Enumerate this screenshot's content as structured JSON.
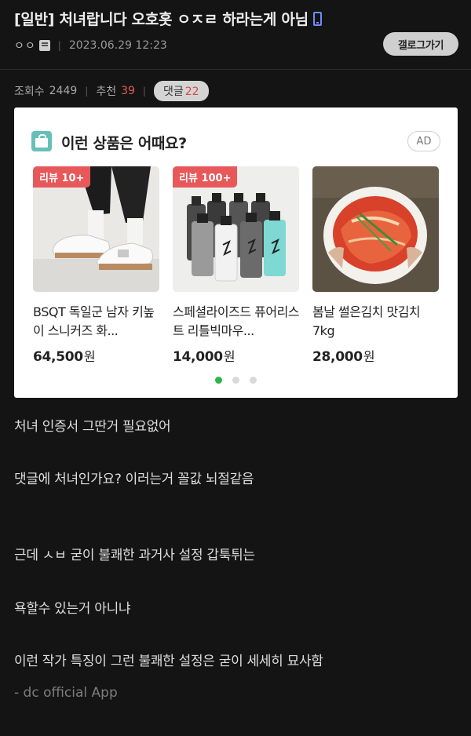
{
  "header": {
    "title": "[일반] 처녀랍니다 오호홋 ㅇㅈㄹ 하라는게 아님",
    "writer": "ㅇㅇ",
    "date": "2023.06.29 12:23",
    "gallery_button": "갤로그가기"
  },
  "stats": {
    "views_label": "조회수",
    "views": "2449",
    "recommend_label": "추천",
    "recommend": "39",
    "comments_label": "댓글",
    "comments": "22"
  },
  "ad": {
    "heading": "이런 상품은 어때요?",
    "badge": "AD",
    "products": [
      {
        "tag": "리뷰 10+",
        "name": "BSQT 독일군 남자 키높이 스니커즈 화...",
        "price": "64,500",
        "unit": "원"
      },
      {
        "tag": "리뷰 100+",
        "name": "스페셜라이즈드 퓨어리스트 리틀빅마우...",
        "price": "14,000",
        "unit": "원"
      },
      {
        "tag": "",
        "name": "봄날 썰은김치 맛김치 7kg",
        "price": "28,000",
        "unit": "원"
      }
    ],
    "page_count": 3,
    "active_page": 0
  },
  "body": {
    "lines": [
      "처녀 인증서 그딴거 필요없어",
      "댓글에 처녀인가요? 이러는거 꼴값 뇌절같음",
      "근데 ㅅㅂ 굳이 불쾌한 과거사 설정 갑툭튀는",
      "욕할수 있는거 아니냐",
      "이런 작가 특징이 그런 불쾌한 설정은 굳이 세세히 묘사함"
    ],
    "signature": "- dc official App"
  },
  "colors": {
    "background": "#141414",
    "accent_red": "#e25d5d",
    "review_tag": "#e7585a",
    "dot_active": "#2fb34a",
    "phone_icon": "#6c8cff"
  },
  "icons": [
    "phone-icon",
    "writer-icon",
    "shopping-bag-icon"
  ]
}
